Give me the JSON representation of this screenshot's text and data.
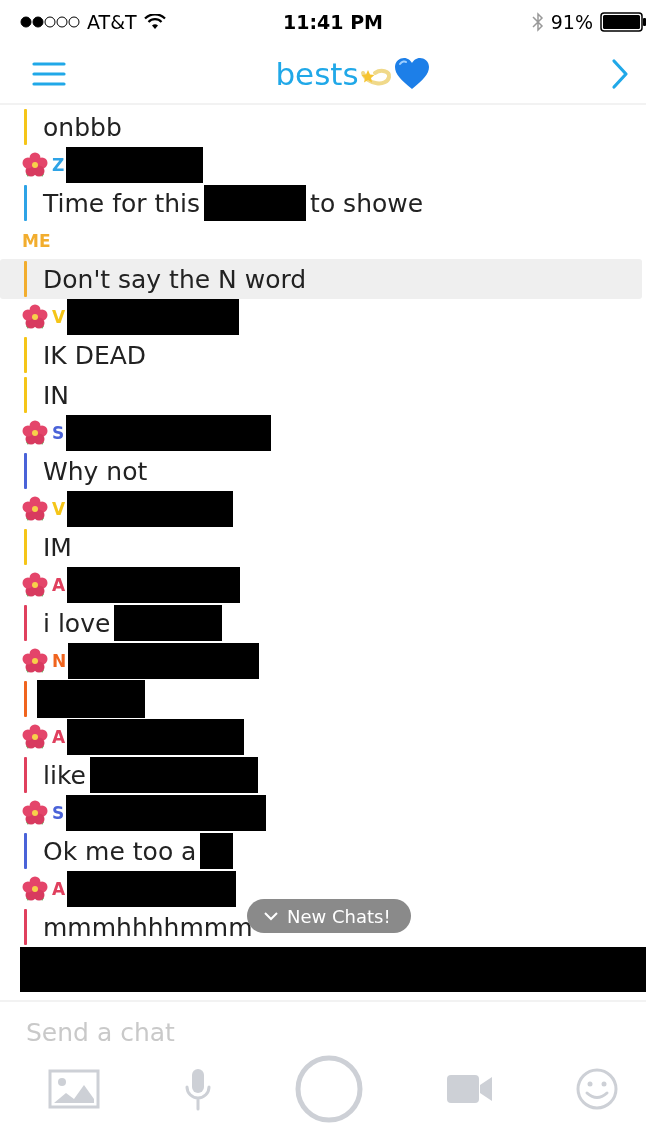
{
  "status_bar": {
    "carrier": "AT&T",
    "time": "11:41 PM",
    "battery": "91%"
  },
  "header": {
    "title": "bests"
  },
  "groups": [
    {
      "color": "#f5c518",
      "lines": [
        {
          "saved": false,
          "segments": [
            {
              "kind": "text",
              "text": "onbbb"
            }
          ]
        }
      ]
    },
    {
      "color": "#2ea3e6",
      "sender": {
        "initial": "Z",
        "friend_emoji": true,
        "redacted": true
      },
      "lines": [
        {
          "saved": false,
          "segments": [
            {
              "kind": "text",
              "text": "Time for this"
            },
            {
              "kind": "redaction"
            },
            {
              "kind": "text",
              "text": "to showe"
            }
          ]
        }
      ]
    },
    {
      "color": "#f2ad2e",
      "sender": {
        "initial": "ME",
        "friend_emoji": false,
        "redacted": false
      },
      "lines": [
        {
          "saved": true,
          "segments": [
            {
              "kind": "text",
              "text": "Don't say the N word"
            }
          ]
        }
      ]
    },
    {
      "color": "#f5c518",
      "sender": {
        "initial": "V",
        "friend_emoji": true,
        "redacted": true
      },
      "lines": [
        {
          "saved": false,
          "segments": [
            {
              "kind": "text",
              "text": "IK DEAD"
            }
          ]
        },
        {
          "saved": false,
          "segments": [
            {
              "kind": "text",
              "text": "IN"
            }
          ]
        }
      ]
    },
    {
      "color": "#4a63d8",
      "sender": {
        "initial": "S",
        "friend_emoji": true,
        "redacted": true
      },
      "lines": [
        {
          "saved": false,
          "segments": [
            {
              "kind": "text",
              "text": "Why not"
            }
          ]
        }
      ]
    },
    {
      "color": "#f5c518",
      "sender": {
        "initial": "V",
        "friend_emoji": true,
        "redacted": true
      },
      "lines": [
        {
          "saved": false,
          "segments": [
            {
              "kind": "text",
              "text": "IM"
            }
          ]
        }
      ]
    },
    {
      "color": "#e0405e",
      "sender": {
        "initial": "A",
        "friend_emoji": true,
        "redacted": true
      },
      "lines": [
        {
          "saved": false,
          "segments": [
            {
              "kind": "text",
              "text": "i love"
            },
            {
              "kind": "redaction"
            }
          ]
        }
      ]
    },
    {
      "color": "#f0641e",
      "sender": {
        "initial": "N",
        "friend_emoji": true,
        "redacted": true
      },
      "lines": [
        {
          "saved": false,
          "segments": [
            {
              "kind": "redaction"
            }
          ]
        }
      ]
    },
    {
      "color": "#e0405e",
      "sender": {
        "initial": "A",
        "friend_emoji": true,
        "redacted": true
      },
      "lines": [
        {
          "saved": false,
          "segments": [
            {
              "kind": "text",
              "text": "like"
            },
            {
              "kind": "redaction"
            }
          ]
        }
      ]
    },
    {
      "color": "#4a63d8",
      "sender": {
        "initial": "S",
        "friend_emoji": true,
        "redacted": true
      },
      "lines": [
        {
          "saved": false,
          "segments": [
            {
              "kind": "text",
              "text": "Ok me too a"
            },
            {
              "kind": "redaction"
            }
          ]
        }
      ]
    },
    {
      "color": "#e0405e",
      "sender": {
        "initial": "A",
        "friend_emoji": true,
        "redacted": true
      },
      "lines": [
        {
          "saved": false,
          "segments": [
            {
              "kind": "text",
              "text": "mmmhhhhmmm"
            }
          ]
        }
      ]
    }
  ],
  "new_chats_pill": {
    "label": "New Chats!"
  },
  "bottom_redacted": true,
  "composer": {
    "placeholder": "Send a chat"
  }
}
